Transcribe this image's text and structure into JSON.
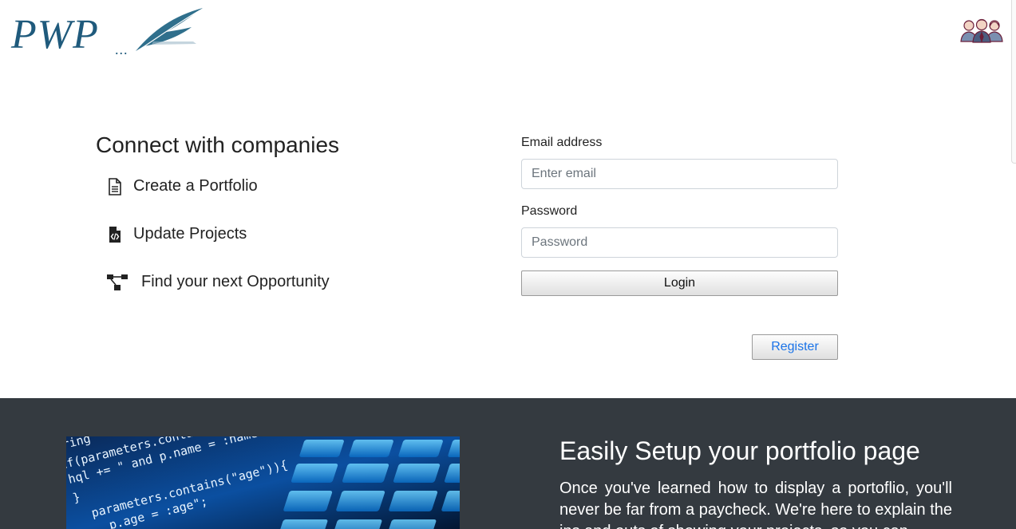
{
  "logo": {
    "text": "PWP",
    "dots": "..."
  },
  "features": {
    "title": "Connect with companies",
    "items": [
      {
        "label": "Create a Portfolio",
        "icon": "document-icon"
      },
      {
        "label": "Update Projects",
        "icon": "code-file-icon"
      },
      {
        "label": "Find your next Opportunity",
        "icon": "network-icon"
      }
    ]
  },
  "login": {
    "email_label": "Email address",
    "email_placeholder": "Enter email",
    "password_label": "Password",
    "password_placeholder": "Password",
    "login_button": "Login",
    "register_button": "Register"
  },
  "promo": {
    "title": "Easily Setup your portfolio page",
    "text": "Once you've learned how to display a portoflio, you'll never be far from a paycheck. We're here to explain the ins and outs of showing your projects, so you can",
    "code_lines": [
      "tring",
      "if(parameters.contains( \"na",
      "  hql += \" and p.name = :name\";",
      "}",
      "parameters.contains(\"age\")){",
      "  p.age = :age\";"
    ]
  },
  "colors": {
    "brand": "#1f5a7c",
    "dark_band": "#343a40",
    "link": "#1a73e8"
  }
}
